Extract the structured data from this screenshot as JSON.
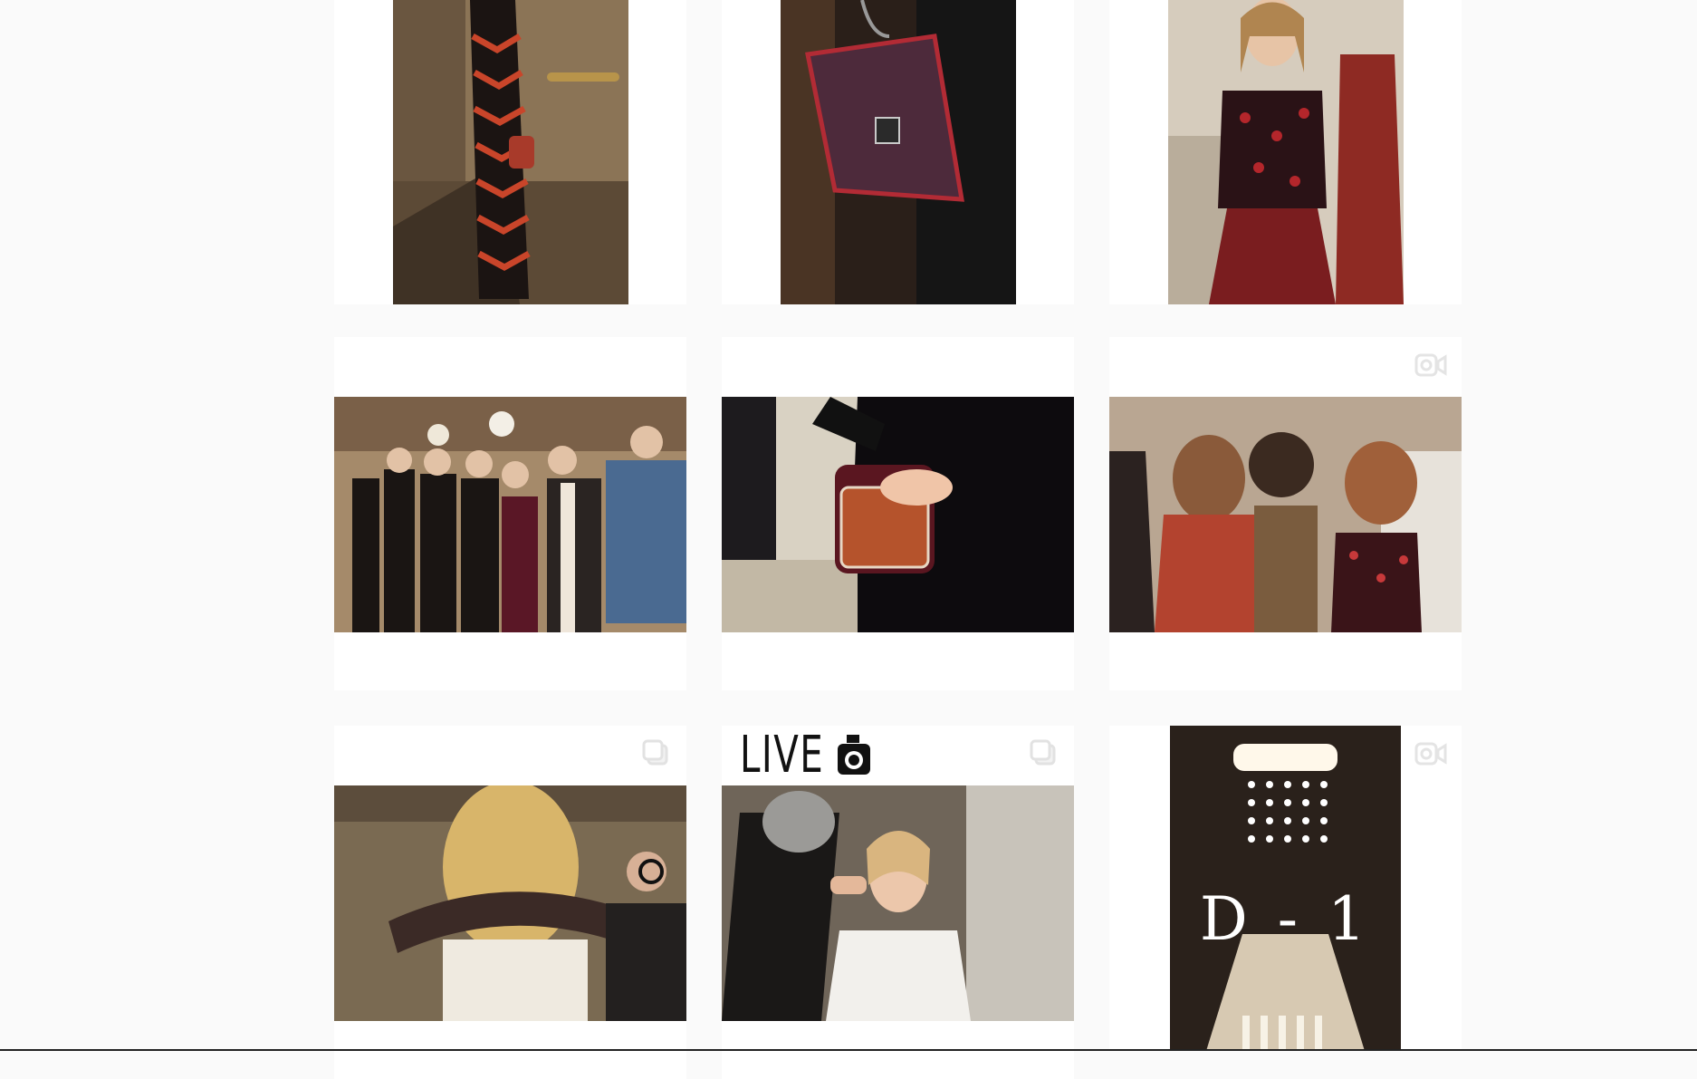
{
  "page": {
    "title": ""
  },
  "grid": {
    "rows": [
      {
        "tiles": [
          {
            "id": "post-1",
            "kind": "photo",
            "badge": "none",
            "alt_icon": "image"
          },
          {
            "id": "post-2",
            "kind": "photo",
            "badge": "none",
            "alt_icon": "image"
          },
          {
            "id": "post-3",
            "kind": "photo",
            "badge": "none",
            "alt_icon": "image"
          }
        ]
      },
      {
        "tiles": [
          {
            "id": "post-4",
            "kind": "photo",
            "badge": "none"
          },
          {
            "id": "post-5",
            "kind": "photo",
            "badge": "gallery-icon"
          },
          {
            "id": "post-6",
            "kind": "video",
            "badge": "video-icon"
          }
        ]
      },
      {
        "tiles": [
          {
            "id": "post-7",
            "kind": "photo",
            "badge": "gallery-icon"
          },
          {
            "id": "post-8",
            "kind": "photo",
            "badge": "gallery-icon",
            "overlay_text": "LIVE"
          },
          {
            "id": "post-9",
            "kind": "video",
            "badge": "video-icon",
            "caption": "D - 1"
          }
        ]
      }
    ]
  },
  "colors": {
    "page_bg": "#fafafa",
    "tile_bg": "#ffffff",
    "badge": "#e9e9e9",
    "burgundy": "#6e1a22",
    "tan": "#a8865e"
  }
}
